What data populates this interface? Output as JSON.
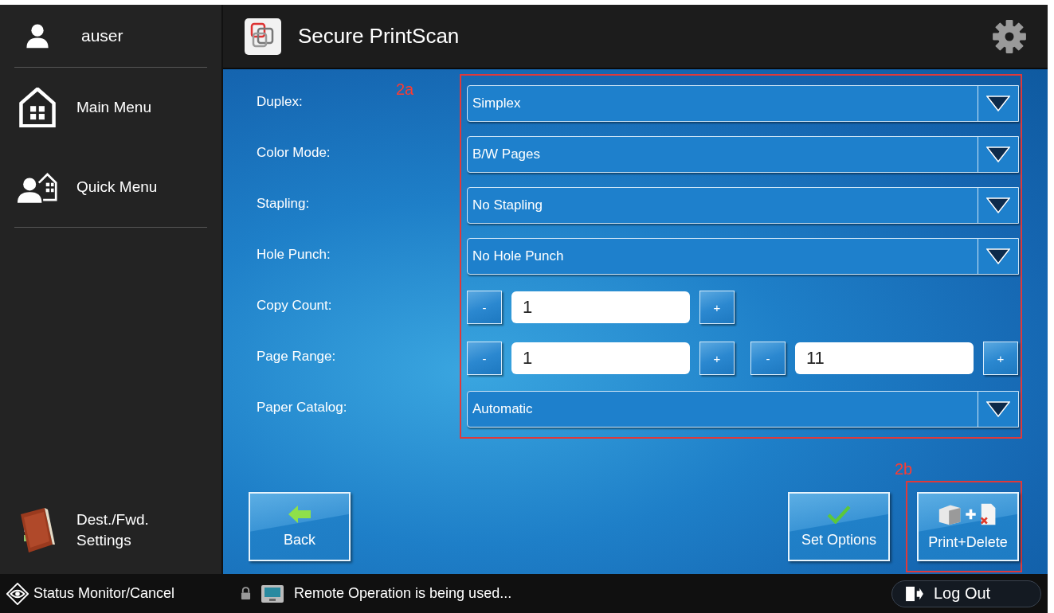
{
  "user": {
    "name": "auser"
  },
  "sidebar": {
    "items": [
      {
        "label": "Main Menu",
        "kind": "home"
      },
      {
        "label": "Quick Menu",
        "kind": "quick"
      }
    ],
    "bottom_item": {
      "label": "Dest./Fwd.\nSettings"
    }
  },
  "header": {
    "title": "Secure PrintScan"
  },
  "form": {
    "annotation": "2a",
    "fields": [
      {
        "label": "Duplex:",
        "kind": "dropdown",
        "value": "Simplex"
      },
      {
        "label": "Color Mode:",
        "kind": "dropdown",
        "value": "B/W Pages"
      },
      {
        "label": "Stapling:",
        "kind": "dropdown",
        "value": "No Stapling"
      },
      {
        "label": "Hole Punch:",
        "kind": "dropdown",
        "value": "No Hole Punch"
      },
      {
        "label": "Copy Count:",
        "kind": "counter",
        "counters": [
          {
            "minus": "-",
            "value": "1",
            "plus": "+"
          }
        ]
      },
      {
        "label": "Page Range:",
        "kind": "counter",
        "counters": [
          {
            "minus": "-",
            "value": "1",
            "plus": "+"
          },
          {
            "minus": "-",
            "value": "11",
            "plus": "+"
          }
        ]
      },
      {
        "label": "Paper Catalog:",
        "kind": "dropdown",
        "value": "Automatic"
      }
    ]
  },
  "actions": [
    {
      "label": "Back",
      "kind": "back"
    },
    {
      "label": "Set Options",
      "kind": "check"
    },
    {
      "label": "Print+Delete",
      "kind": "print-delete",
      "annotation": "2b"
    }
  ],
  "status_bar": {
    "monitor": "Status Monitor/Cancel",
    "message": "Remote Operation is being used...",
    "logout": "Log Out"
  }
}
